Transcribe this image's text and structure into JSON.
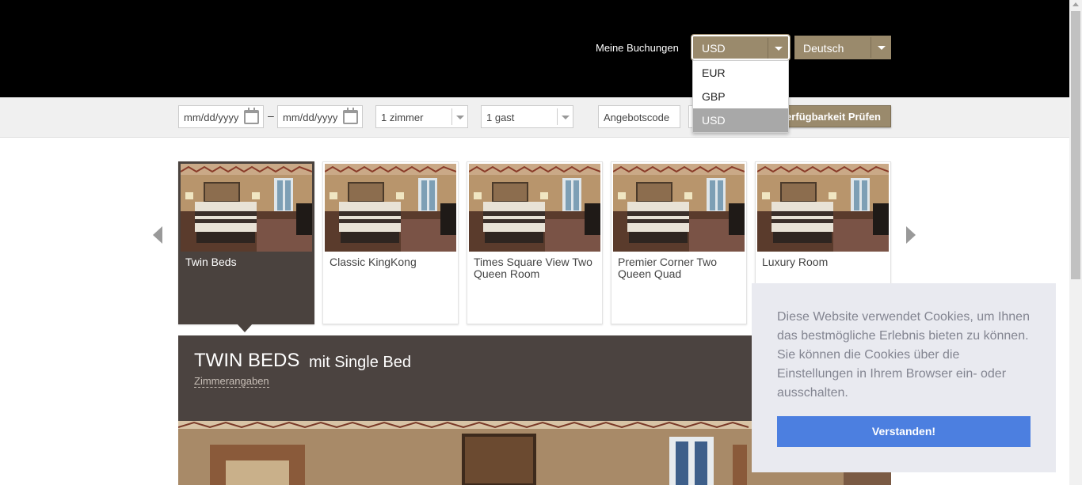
{
  "header": {
    "my_bookings": "Meine Buchungen",
    "currency": {
      "selected": "USD",
      "options": [
        "EUR",
        "GBP",
        "USD"
      ]
    },
    "language": {
      "selected": "Deutsch"
    }
  },
  "search": {
    "checkin_placeholder": "mm/dd/yyyy",
    "date_separator": "–",
    "checkout_placeholder": "mm/dd/yyyy",
    "rooms": "1 zimmer",
    "guests": "1 gast",
    "promo_placeholder": "Angebotscode",
    "check_button": "Verfügbarkeit Prüfen"
  },
  "rooms": [
    {
      "name": "Twin Beds",
      "active": true
    },
    {
      "name": "Classic KingKong"
    },
    {
      "name": "Times Square View Two Queen Room"
    },
    {
      "name": "Premier Corner Two Queen Quad"
    },
    {
      "name": "Luxury Room"
    }
  ],
  "room_detail": {
    "title": "TWIN BEDS",
    "subtitle": "mit Single Bed",
    "details_link": "Zimmerangaben"
  },
  "cookie": {
    "text": "Diese Website verwendet Cookies, um Ihnen das bestmögliche Erlebnis bieten zu können. Sie können die Cookies über die Einstellungen in Ihrem Browser ein- oder ausschalten.",
    "button": "Verstanden!"
  },
  "colors": {
    "accent": "#9a8a6c",
    "active_card": "#4a423e",
    "cookie_button": "#4c7fe0"
  }
}
